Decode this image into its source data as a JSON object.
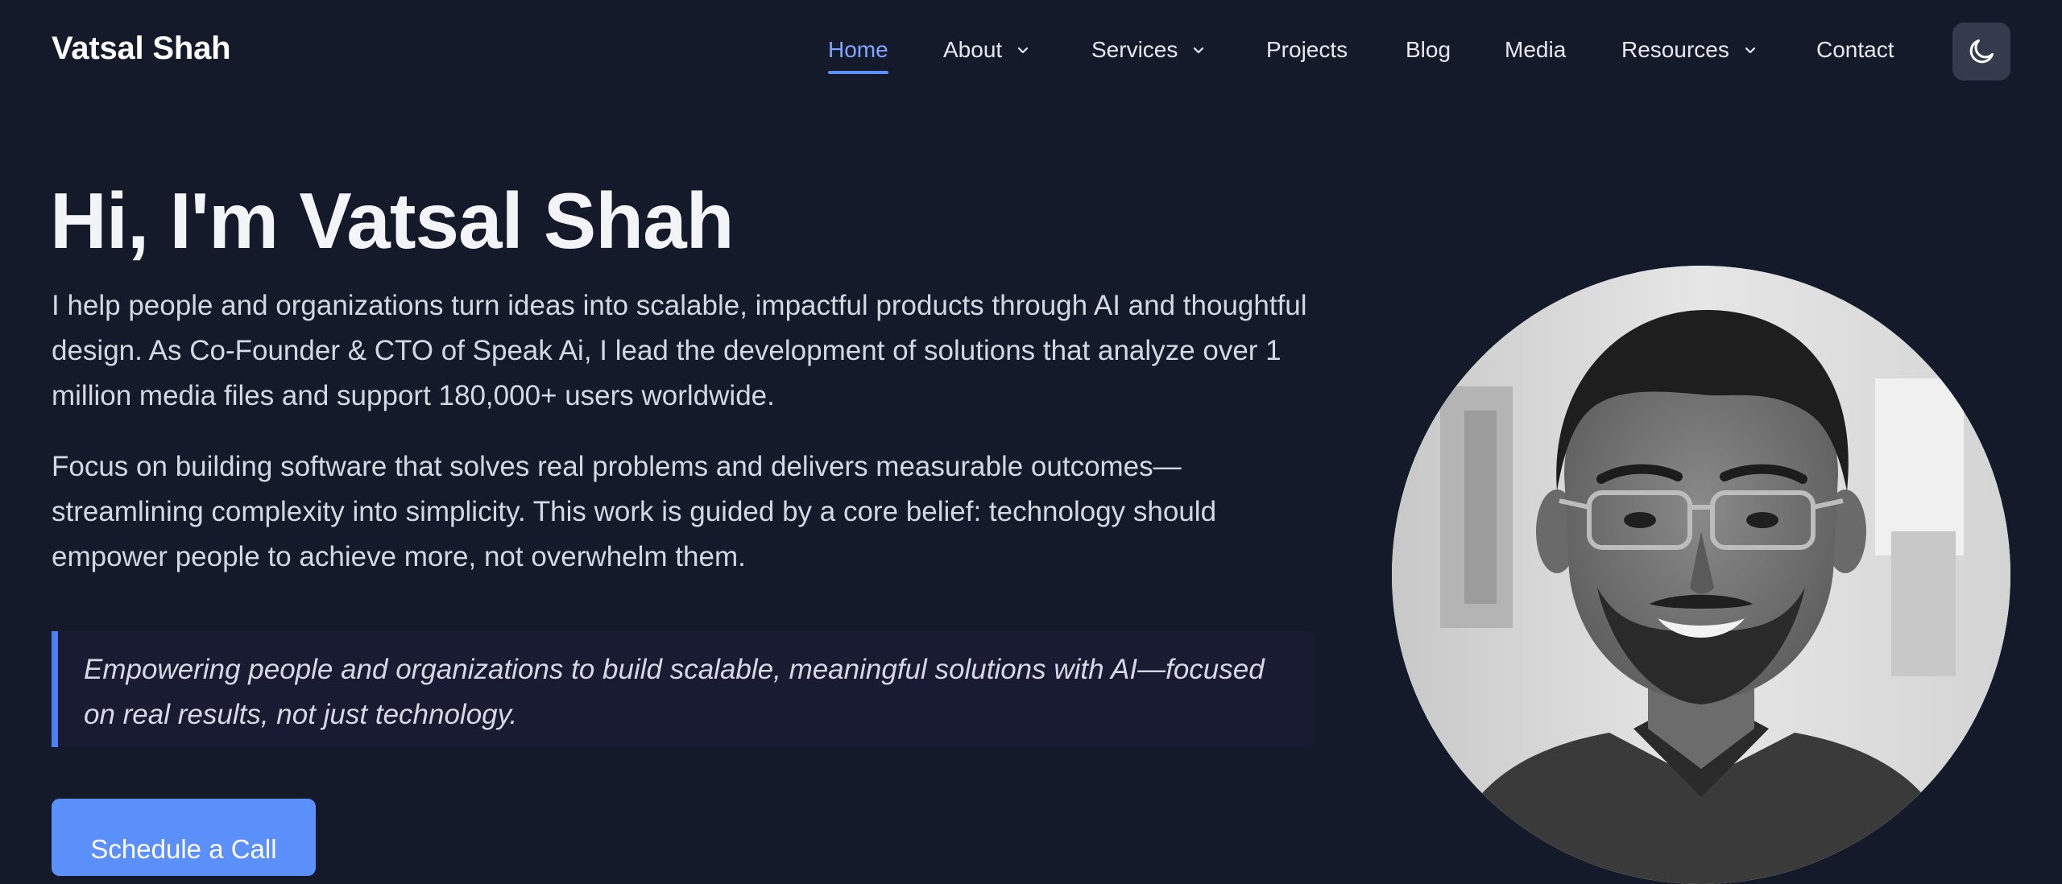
{
  "header": {
    "brand": "Vatsal Shah",
    "nav": [
      {
        "label": "Home",
        "active": true,
        "dropdown": false
      },
      {
        "label": "About",
        "active": false,
        "dropdown": true
      },
      {
        "label": "Services",
        "active": false,
        "dropdown": true
      },
      {
        "label": "Projects",
        "active": false,
        "dropdown": false
      },
      {
        "label": "Blog",
        "active": false,
        "dropdown": false
      },
      {
        "label": "Media",
        "active": false,
        "dropdown": false
      },
      {
        "label": "Resources",
        "active": false,
        "dropdown": true
      },
      {
        "label": "Contact",
        "active": false,
        "dropdown": false
      }
    ],
    "theme_toggle_icon": "moon-icon"
  },
  "hero": {
    "title": "Hi, I'm Vatsal Shah",
    "paragraphs": [
      "I help people and organizations turn ideas into scalable, impactful products through AI and thoughtful design. As Co-Founder & CTO of Speak Ai, I lead the development of solutions that analyze over 1 million media files and support 180,000+ users worldwide.",
      "Focus on building software that solves real problems and delivers measurable outcomes—streamlining complexity into simplicity. This work is guided by a core belief: technology should empower people to achieve more, not overwhelm them."
    ],
    "quote": "Empowering people and organizations to build scalable, meaningful solutions with AI—focused on real results, not just technology.",
    "cta_label": "Schedule a Call",
    "portrait_icon": "portrait-photo"
  },
  "colors": {
    "background": "#151a2b",
    "accent": "#5b8ff9",
    "active_nav": "#7ea5ff",
    "quote_background": "#181b31",
    "theme_button": "#343b4d"
  }
}
